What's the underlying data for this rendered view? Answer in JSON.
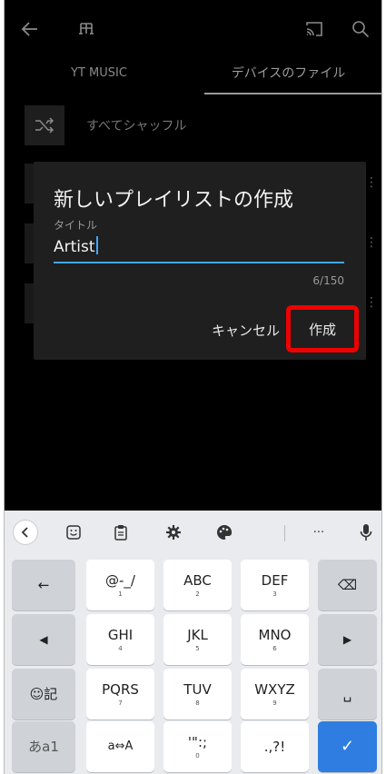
{
  "appbar": {
    "icons": [
      "arrow-left-icon",
      "music-note-icon",
      "cast-icon",
      "search-icon"
    ]
  },
  "tabs": [
    {
      "label": "YT MUSIC",
      "selected": false
    },
    {
      "label": "デバイスのファイル",
      "selected": true
    }
  ],
  "shuffle": {
    "label": "すべてシャッフル"
  },
  "dialog": {
    "title": "新しいプレイリストの作成",
    "field_label": "タイトル",
    "input_value": "Artist",
    "counter": "6/150",
    "cancel_label": "キャンセル",
    "create_label": "作成",
    "accent": "#3ea6ff",
    "highlight": "#e00000"
  },
  "keyboard": {
    "toolbar": [
      "chevron-left-icon",
      "emoji-icon",
      "clipboard-icon",
      "settings-gear-icon",
      "palette-icon",
      "more-icon",
      "microphone-icon"
    ],
    "more_label": "···",
    "rows": [
      [
        {
          "main": "←"
        },
        {
          "main": "@-_/",
          "sub": "1"
        },
        {
          "main": "ABC",
          "sub": "2"
        },
        {
          "main": "DEF",
          "sub": "3"
        },
        {
          "main": "⌫"
        }
      ],
      [
        {
          "main": "◀"
        },
        {
          "main": "GHI",
          "sub": "4"
        },
        {
          "main": "JKL",
          "sub": "5"
        },
        {
          "main": "MNO",
          "sub": "6"
        },
        {
          "main": "▶"
        }
      ],
      [
        {
          "main": "☺記"
        },
        {
          "main": "PQRS",
          "sub": "7"
        },
        {
          "main": "TUV",
          "sub": "8"
        },
        {
          "main": "WXYZ",
          "sub": "9"
        },
        {
          "main": "␣"
        }
      ],
      [
        {
          "main": "あa1"
        },
        {
          "main": "a⇔A"
        },
        {
          "main": "'\":;",
          "sub": "0"
        },
        {
          "main": ".,?!"
        },
        {
          "main": "✓"
        }
      ]
    ],
    "enter_color": "#2f7de1"
  }
}
